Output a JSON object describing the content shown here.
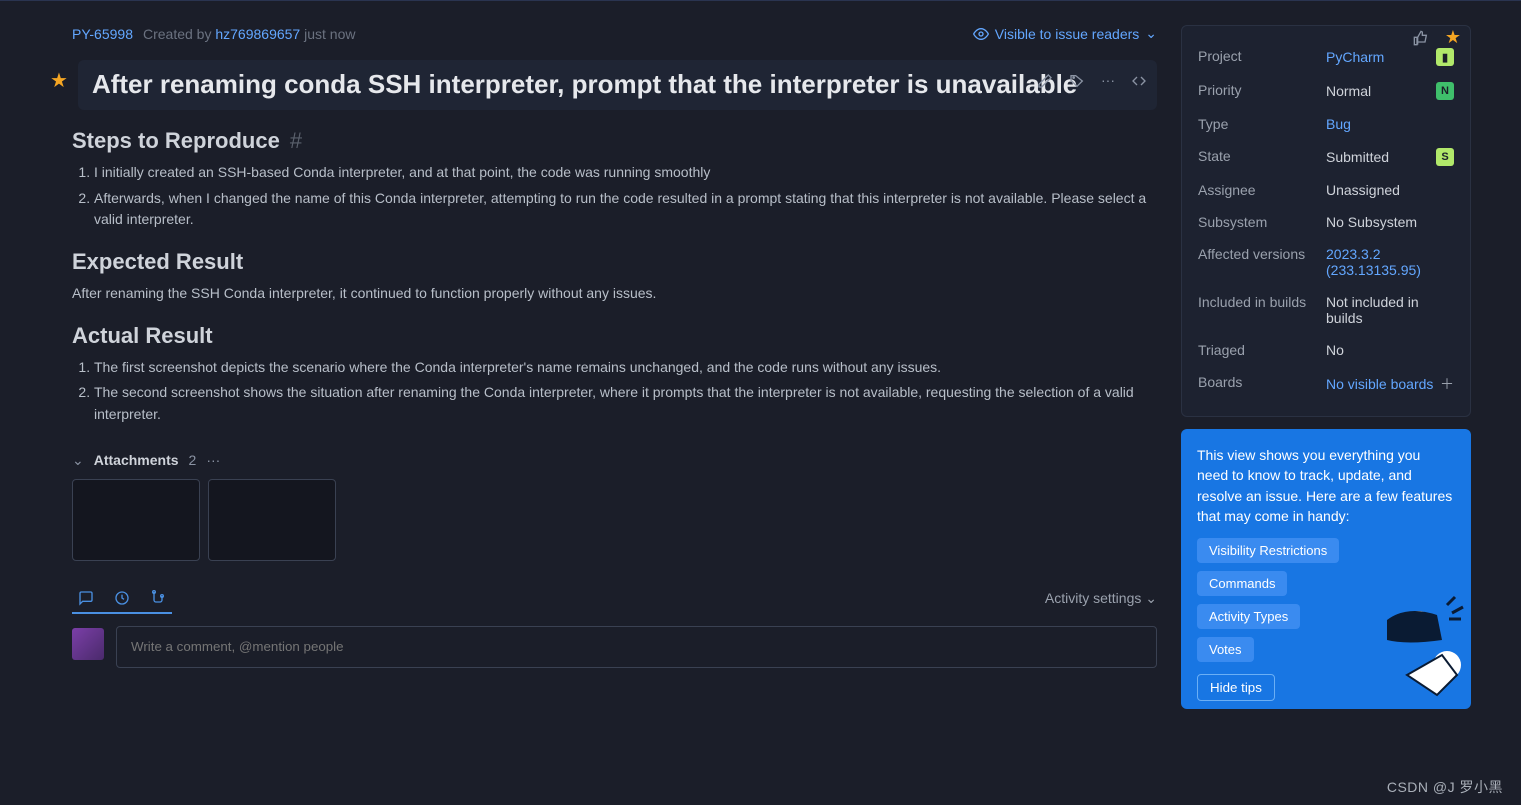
{
  "meta": {
    "issue_id": "PY-65998",
    "created_by_label": "Created by",
    "author": "hz769869657",
    "timestamp": "just now"
  },
  "visibility": {
    "label": "Visible to issue readers"
  },
  "title": "After renaming conda SSH interpreter, prompt that the interpreter is unavailable",
  "sections": {
    "steps_title": "Steps to Reproduce",
    "steps": [
      "I initially created an SSH-based Conda interpreter, and at that point, the code was running smoothly",
      "Afterwards, when I changed the name of this Conda interpreter, attempting to run the code resulted in a prompt stating that this interpreter is not available. Please select a valid interpreter."
    ],
    "expected_title": "Expected Result",
    "expected_body": "After renaming the SSH Conda interpreter, it continued to function properly without any issues.",
    "actual_title": "Actual Result",
    "actual": [
      "The first screenshot depicts the scenario where the Conda interpreter's name remains unchanged, and the code runs without any issues.",
      "The second screenshot shows the situation after renaming the Conda interpreter, where it prompts that the interpreter is not available, requesting the selection of a valid interpreter."
    ]
  },
  "attachments": {
    "label": "Attachments",
    "count": "2"
  },
  "activity_settings": "Activity settings",
  "comment_placeholder": "Write a comment, @mention people",
  "sidebar": {
    "project": {
      "label": "Project",
      "value": "PyCharm"
    },
    "priority": {
      "label": "Priority",
      "value": "Normal"
    },
    "type": {
      "label": "Type",
      "value": "Bug"
    },
    "state": {
      "label": "State",
      "value": "Submitted"
    },
    "assignee": {
      "label": "Assignee",
      "value": "Unassigned"
    },
    "subsystem": {
      "label": "Subsystem",
      "value": "No Subsystem"
    },
    "affected": {
      "label": "Affected versions",
      "value": "2023.3.2 (233.13135.95)"
    },
    "included": {
      "label": "Included in builds",
      "value": "Not included in builds"
    },
    "triaged": {
      "label": "Triaged",
      "value": "No"
    },
    "boards": {
      "label": "Boards",
      "value": "No visible boards"
    }
  },
  "tips": {
    "body": "This view shows you everything you need to know to track, update, and resolve an issue. Here are a few features that may come in handy:",
    "pills": [
      "Visibility Restrictions",
      "Commands",
      "Activity Types",
      "Votes"
    ],
    "hide": "Hide tips"
  },
  "watermark": "CSDN @J 罗小黑"
}
